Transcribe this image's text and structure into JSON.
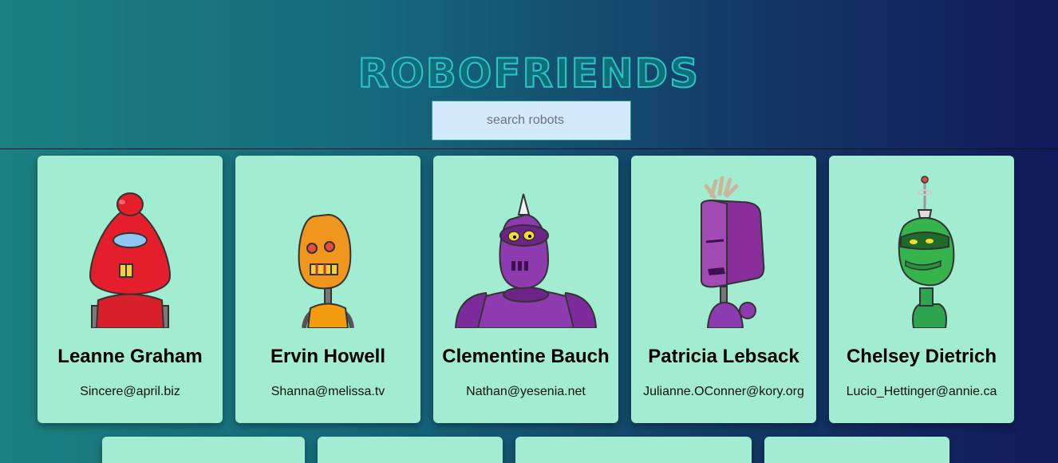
{
  "header": {
    "title": "RoboFriends"
  },
  "search": {
    "placeholder": "search robots"
  },
  "robots": [
    {
      "name": "Leanne Graham",
      "email": "Sincere@april.biz"
    },
    {
      "name": "Ervin Howell",
      "email": "Shanna@melissa.tv"
    },
    {
      "name": "Clementine Bauch",
      "email": "Nathan@yesenia.net"
    },
    {
      "name": "Patricia Lebsack",
      "email": "Julianne.OConner@kory.org"
    },
    {
      "name": "Chelsey Dietrich",
      "email": "Lucio_Hettinger@annie.ca"
    }
  ],
  "colors": {
    "card_bg": "#a2ecd2",
    "search_bg": "#d2eafc",
    "title_outline": "#2fc4c8"
  }
}
